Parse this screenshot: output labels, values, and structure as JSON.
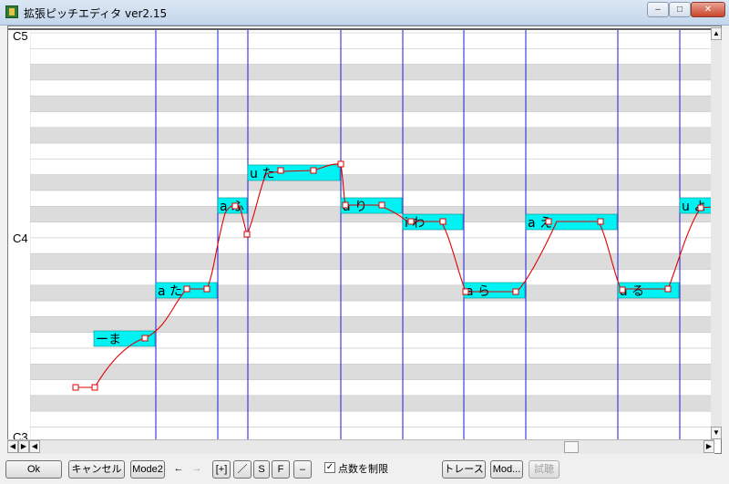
{
  "window": {
    "title": "拡張ピッチエディタ ver2.15",
    "min_label": "–",
    "max_label": "□",
    "close_label": "✕"
  },
  "editor": {
    "octave_labels": [
      "C5",
      "C4",
      "C3"
    ],
    "notes": [
      {
        "label": "ーま"
      },
      {
        "label": "a た"
      },
      {
        "label": "a ふ"
      },
      {
        "label": "u た"
      },
      {
        "label": "a り"
      },
      {
        "label": "i わ"
      },
      {
        "label": "a ら"
      },
      {
        "label": "a え"
      },
      {
        "label": "a る"
      },
      {
        "label": "u よ"
      }
    ],
    "colors": {
      "note_fill": "#00f2f2",
      "pitch_line": "#e00000",
      "bar_line": "#1a1ad6",
      "black_key_row": "#dcdcdc"
    }
  },
  "scrollbar": {
    "left_arrow": "◀",
    "right_arrow": "▶",
    "up_arrow": "▲",
    "down_arrow": "▼"
  },
  "toolbar": {
    "ok": "Ok",
    "cancel": "キャンセル",
    "mode2": "Mode2",
    "undo": "←",
    "redo": "→",
    "add_point": "[+]",
    "line": "／",
    "smooth": "S",
    "flat": "F",
    "minus": "–",
    "limit_points_checked": "✓",
    "limit_points_label": "点数を制限",
    "trace": "トレース",
    "mod": "Mod...",
    "preview": "試聴"
  }
}
